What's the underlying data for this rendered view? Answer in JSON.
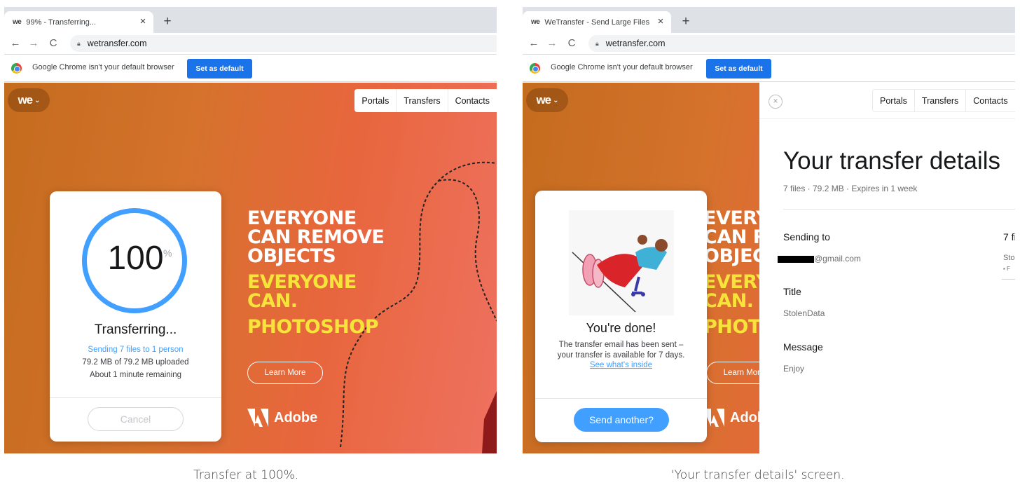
{
  "left": {
    "tab": {
      "favicon": "we",
      "title": "99% - Transferring...",
      "close": "×",
      "new_tab": "+"
    },
    "nav": {
      "back": "←",
      "forward": "→",
      "reload": "C",
      "url": "wetransfer.com"
    },
    "infobar": {
      "text": "Google Chrome isn't your default browser",
      "button": "Set as default"
    },
    "page": {
      "logo": "we",
      "top_nav": [
        "Portals",
        "Transfers",
        "Contacts"
      ],
      "ad": {
        "lines_white": [
          "EVERYONE",
          "CAN REMOVE",
          "OBJECTS"
        ],
        "lines_yellow_1": [
          "EVERYONE",
          "CAN."
        ],
        "line_yellow_2": "PHOTOSHOP",
        "button": "Learn More",
        "brand": "Adobe"
      },
      "progress_card": {
        "percent": "100",
        "percent_sign": "%",
        "progress_value": 100,
        "status": "Transferring...",
        "sending": "Sending 7 files to 1 person",
        "uploaded": "79.2 MB of 79.2 MB uploaded",
        "remaining": "About 1 minute remaining",
        "cancel": "Cancel"
      }
    },
    "caption": "Transfer at 100%."
  },
  "right": {
    "tab": {
      "favicon": "we",
      "title": "WeTransfer - Send Large Files &",
      "close": "×",
      "new_tab": "+"
    },
    "nav": {
      "back": "←",
      "forward": "→",
      "reload": "C",
      "url": "wetransfer.com"
    },
    "infobar": {
      "text": "Google Chrome isn't your default browser",
      "button": "Set as default"
    },
    "page": {
      "logo": "we",
      "ad_fragments": [
        "EVERY",
        "CAN R",
        "OBJEC",
        "EVERY",
        "CAN.",
        "PHOT"
      ],
      "ad_button": "Learn More",
      "ad_brand": "Adob",
      "done_card": {
        "title": "You're done!",
        "text_line1": "The transfer email has been sent –",
        "text_line2": "your transfer is available for 7 days.",
        "link": "See what's inside",
        "button": "Send another?"
      },
      "details": {
        "close": "×",
        "top_nav": [
          "Portals",
          "Transfers",
          "Contacts"
        ],
        "title": "Your transfer details",
        "meta": "7 files · 79.2 MB · Expires in 1 week",
        "sending_to_label": "Sending to",
        "sending_to_value": "@gmail.com",
        "title_label": "Title",
        "title_value": "StolenData",
        "message_label": "Message",
        "message_value": "Enjoy",
        "files_label": "7 fi",
        "files_value": "Sto",
        "files_sub": "▪ F"
      }
    },
    "caption": "'Your transfer details' screen."
  },
  "colors": {
    "accent_blue": "#409fff",
    "chrome_blue": "#1a73e8",
    "ad_yellow": "#f7e43a",
    "bg_orange": "#d5722c"
  }
}
